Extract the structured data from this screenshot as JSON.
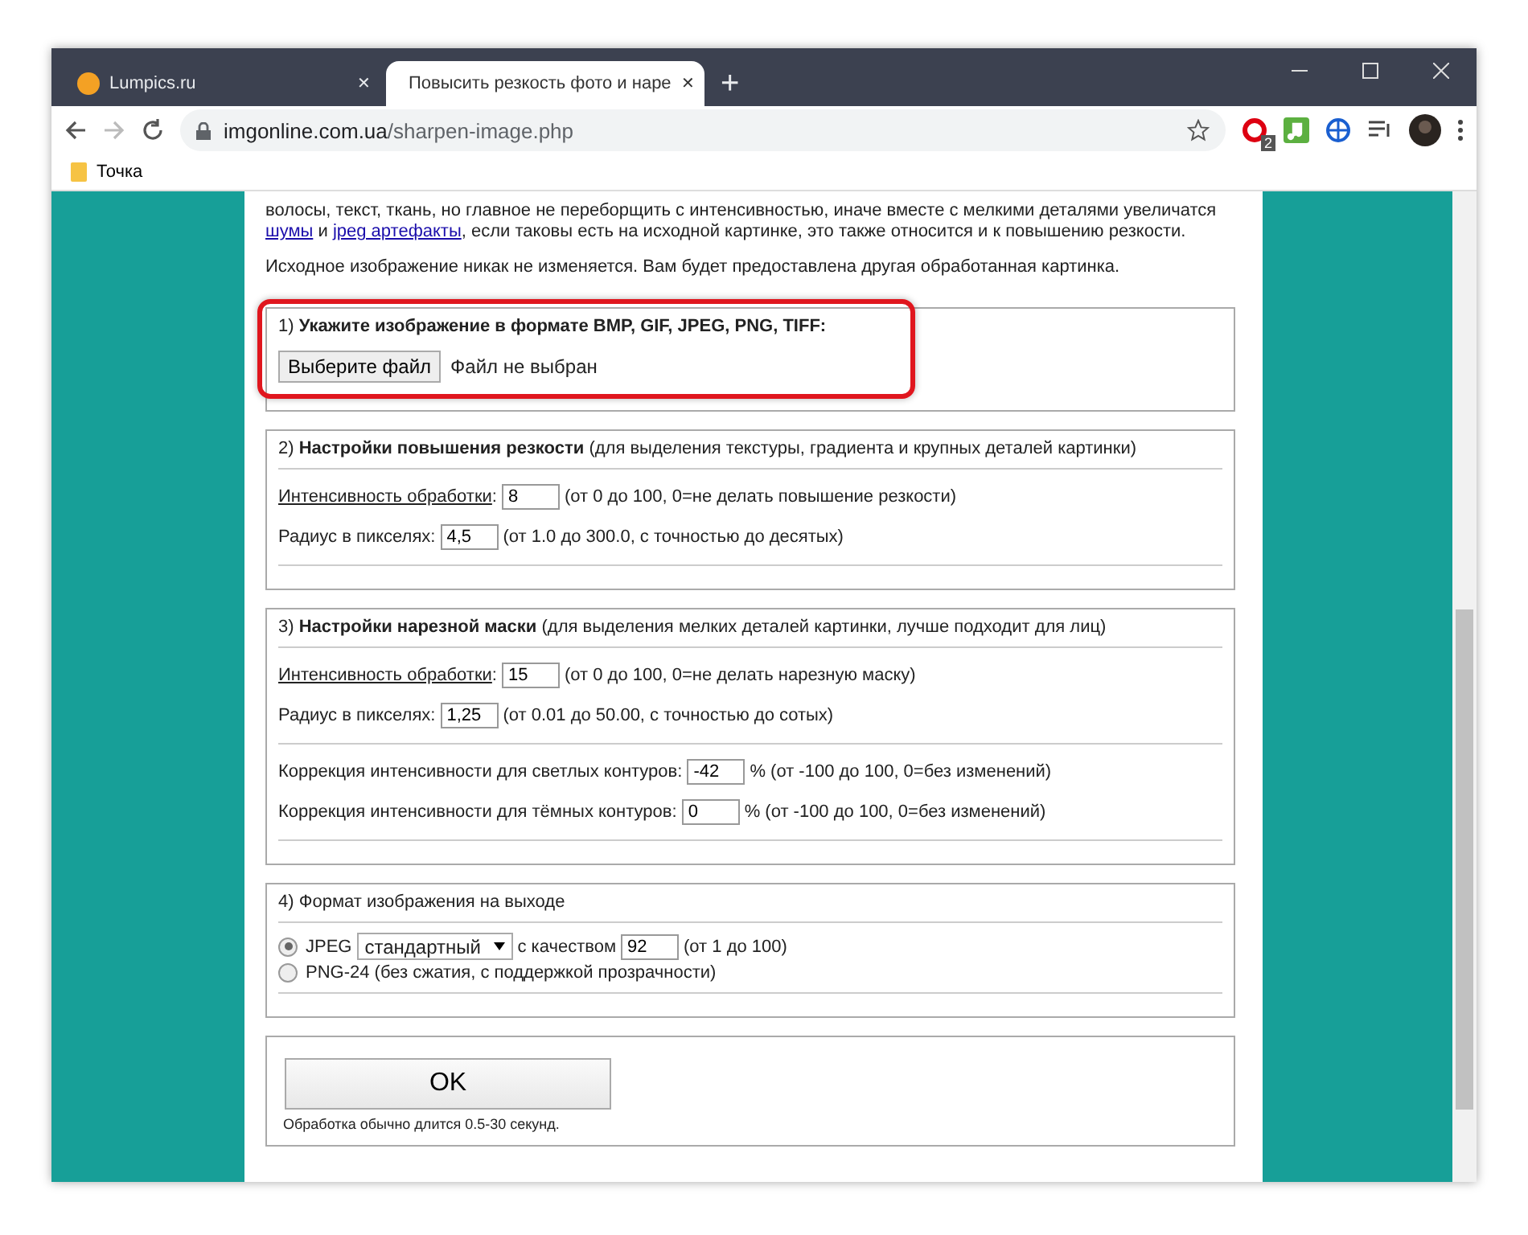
{
  "tabs": [
    {
      "title": "Lumpics.ru",
      "close": "✕",
      "selected": false
    },
    {
      "title": "Повысить резкость фото и наре",
      "close": "✕",
      "selected": true
    }
  ],
  "new_tab": "+",
  "address": {
    "host": "imgonline.com.ua",
    "path": "/sharpen-image.php"
  },
  "extensions": {
    "badge": "2"
  },
  "bookmarks": [
    {
      "label": "Точка"
    }
  ],
  "intro": [
    {
      "parts": [
        {
          "text": "волосы, текст, ткань, но главное не переборщить с интенсивностью, иначе вместе с мелкими деталями увеличатся ",
          "kind": "text"
        },
        {
          "text": "шумы",
          "kind": "link"
        },
        {
          "text": " и ",
          "kind": "text"
        },
        {
          "text": "jpeg артефакты",
          "kind": "link"
        },
        {
          "text": ", если таковы есть на исходной картинке, это также относится и к повышению резкости.",
          "kind": "text"
        }
      ]
    },
    {
      "parts": [
        {
          "text": "Исходное изображение никак не изменяется. Вам будет предоставлена другая обработанная картинка.",
          "kind": "text"
        }
      ]
    }
  ],
  "sections": [
    {
      "number": "1)",
      "title": "Укажите изображение в формате BMP, GIF, JPEG, PNG, TIFF:",
      "highlighted": true,
      "plain_title": false,
      "groups": [
        [
          {
            "kind": "file",
            "button": "Выберите файл",
            "status": "Файл не выбран"
          }
        ]
      ],
      "rule_after": false
    },
    {
      "number": "2)",
      "title": "Настройки повышения резкости",
      "note": "(для выделения текстуры, градиента и крупных деталей картинки)",
      "highlighted": false,
      "plain_title": false,
      "groups": [
        [
          {
            "kind": "field",
            "label": "Интенсивность обработки",
            "underlined": true,
            "colon": ":",
            "value": "8",
            "hint": "(от 0 до 100, 0=не делать повышение резкости)"
          },
          {
            "kind": "field",
            "label": "Радиус в пикселях",
            "underlined": false,
            "colon": ":",
            "value": "4,5",
            "hint": "(от 1.0 до 300.0, с точностью до десятых)"
          }
        ]
      ],
      "rule_after": true
    },
    {
      "number": "3)",
      "title": "Настройки нарезной маски",
      "note": "(для выделения мелких деталей картинки, лучше подходит для лиц)",
      "highlighted": false,
      "plain_title": false,
      "groups": [
        [
          {
            "kind": "field",
            "label": "Интенсивность обработки",
            "underlined": true,
            "colon": ":",
            "value": "15",
            "hint": "(от 0 до 100, 0=не делать нарезную маску)"
          },
          {
            "kind": "field",
            "label": "Радиус в пикселях",
            "underlined": false,
            "colon": ":",
            "value": "1,25",
            "hint": "(от 0.01 до 50.00, с точностью до сотых)"
          }
        ],
        [
          {
            "kind": "field",
            "label": "Коррекция интенсивности для светлых контуров",
            "underlined": false,
            "colon": ":",
            "value": "-42",
            "hint": "% (от -100 до 100, 0=без изменений)"
          },
          {
            "kind": "field",
            "label": "Коррекция интенсивности для тёмных контуров",
            "underlined": false,
            "colon": ":",
            "value": "0",
            "hint": "% (от -100 до 100, 0=без изменений)"
          }
        ]
      ],
      "rule_after": true
    },
    {
      "number": "4)",
      "title": "Формат изображения на выходе",
      "highlighted": false,
      "plain_title": true,
      "groups": [
        [
          {
            "kind": "radio",
            "label": "JPEG",
            "selected": true,
            "select": "стандартный",
            "quality_label": "с качеством",
            "value": "92",
            "hint": "(от 1 до 100)"
          },
          {
            "kind": "radio",
            "label": "PNG-24 (без сжатия, с поддержкой прозрачности)",
            "selected": false
          }
        ]
      ],
      "rule_after": true
    }
  ],
  "submit": {
    "label": "OK",
    "note": "Обработка обычно длится 0.5-30 секунд."
  }
}
